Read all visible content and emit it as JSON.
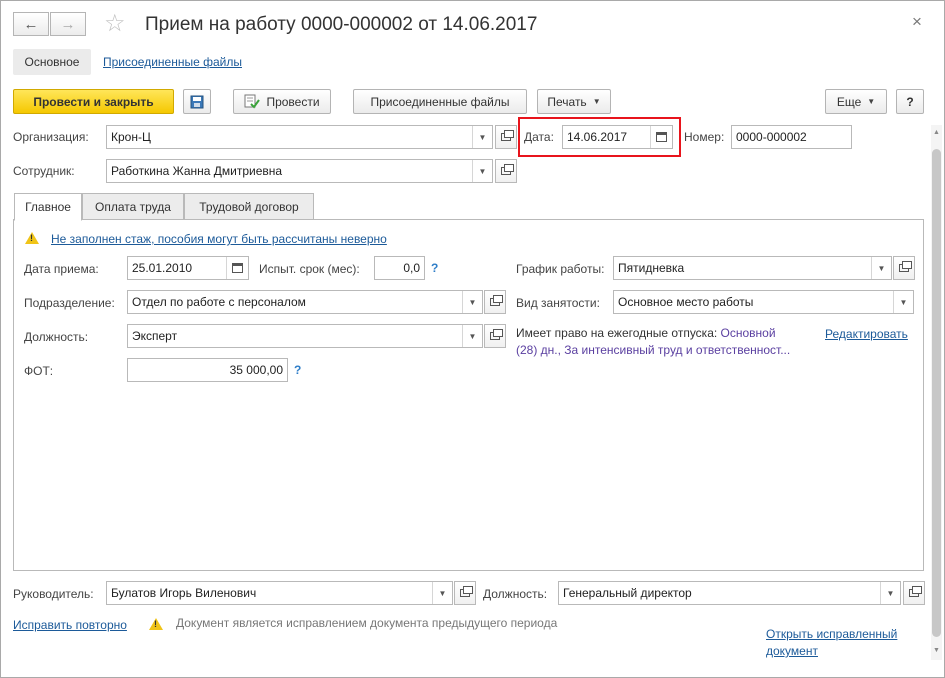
{
  "window": {
    "title": "Прием на работу 0000-000002 от 14.06.2017"
  },
  "sections": {
    "main": "Основное",
    "attached": "Присоединенные файлы"
  },
  "toolbar": {
    "post_close": "Провести и закрыть",
    "post": "Провести",
    "attached_files": "Присоединенные файлы",
    "print": "Печать",
    "more": "Еще",
    "help": "?"
  },
  "header": {
    "org_label": "Организация:",
    "org_value": "Крон-Ц",
    "date_label": "Дата:",
    "date_value": "14.06.2017",
    "number_label": "Номер:",
    "number_value": "0000-000002",
    "employee_label": "Сотрудник:",
    "employee_value": "Работкина Жанна Дмитриевна"
  },
  "tabs": [
    "Главное",
    "Оплата труда",
    "Трудовой договор"
  ],
  "main_tab": {
    "warning": "Не заполнен стаж, пособия могут быть рассчитаны неверно",
    "hire_date_label": "Дата приема:",
    "hire_date_value": "25.01.2010",
    "probation_label": "Испыт. срок (мес):",
    "probation_value": "0,0",
    "schedule_label": "График работы:",
    "schedule_value": "Пятидневка",
    "department_label": "Подразделение:",
    "department_value": "Отдел по работе с персоналом",
    "employment_label": "Вид занятости:",
    "employment_value": "Основное место работы",
    "position_label": "Должность:",
    "position_value": "Эксперт",
    "vacation_label": "Имеет право на ежегодные отпуска:",
    "vacation_value_1": "Основной",
    "vacation_value_2": "(28) дн., За интенсивный труд и ответственност...",
    "edit_link": "Редактировать",
    "payroll_label": "ФОТ:",
    "payroll_value": "35 000,00",
    "help": "?"
  },
  "footer": {
    "manager_label": "Руководитель:",
    "manager_value": "Булатов Игорь Виленович",
    "position_label": "Должность:",
    "position_value": "Генеральный директор",
    "fix_again": "Исправить повторно",
    "correction_note": "Документ является исправлением документа предыдущего периода",
    "open_fixed_1": "Открыть исправленный",
    "open_fixed_2": "документ"
  },
  "colors": {
    "primary_button": "#f5c800",
    "link": "#1c5a99",
    "highlight": "#e8141c",
    "warning": "#f0c418"
  }
}
